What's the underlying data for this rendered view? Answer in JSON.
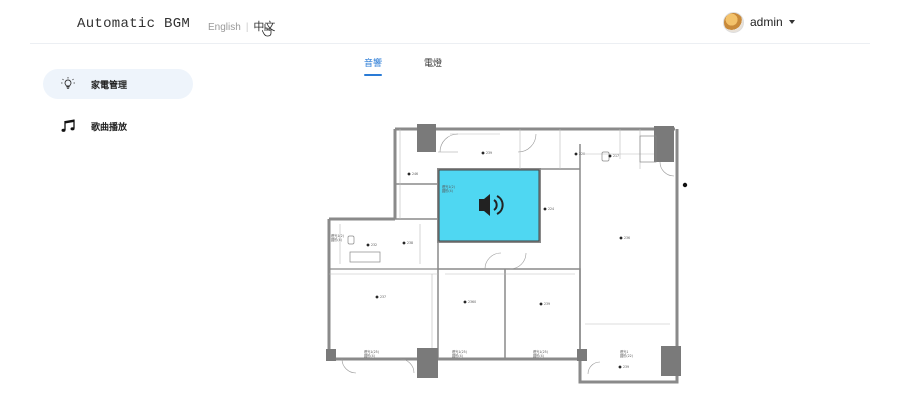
{
  "header": {
    "brand": "Automatic BGM",
    "lang_en": "English",
    "lang_separator": "|",
    "lang_zh": "中文",
    "user_name": "admin"
  },
  "sidebar": {
    "items": [
      {
        "label": "家電管理",
        "icon": "lightbulb-icon",
        "active": true
      },
      {
        "label": "歌曲播放",
        "icon": "music-note-icon",
        "active": false
      }
    ]
  },
  "tabs": [
    {
      "label": "音響",
      "active": true
    },
    {
      "label": "電燈",
      "active": false
    }
  ],
  "colors": {
    "accent": "#2a7bd6",
    "active_room": "#4fd7f2",
    "wall": "#8a8a8a",
    "pillar": "#7a7a7a"
  },
  "floorplan": {
    "active_icon": "speaker-icon",
    "devices": [
      "239",
      "220",
      "217",
      "246",
      "224",
      "236",
      "232",
      "238",
      "237",
      "2360",
      "239",
      "239"
    ],
    "room_tags": [
      "燈光1(2)\n圓形(4)",
      "燈光1(2)\n圓形(4)",
      "燈光1(25)\n圓形(4)",
      "燈光1(25)\n圓形(4)",
      "燈光1(25)\n圓形(4)",
      "燈光1\n圓形(22)"
    ]
  }
}
